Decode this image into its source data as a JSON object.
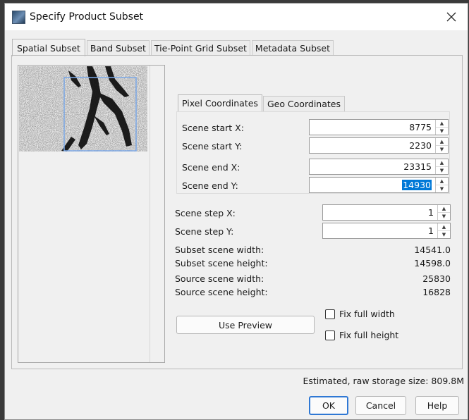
{
  "window": {
    "title": "Specify Product Subset"
  },
  "tabs": [
    {
      "label": "Spatial Subset",
      "active": true
    },
    {
      "label": "Band Subset",
      "active": false
    },
    {
      "label": "Tie-Point Grid Subset",
      "active": false
    },
    {
      "label": "Metadata Subset",
      "active": false
    }
  ],
  "coord_tabs": [
    {
      "label": "Pixel Coordinates",
      "active": true
    },
    {
      "label": "Geo Coordinates",
      "active": false
    }
  ],
  "fields": {
    "scene_start_x": {
      "label": "Scene start X:",
      "value": "8775"
    },
    "scene_start_y": {
      "label": "Scene start Y:",
      "value": "2230"
    },
    "scene_end_x": {
      "label": "Scene end X:",
      "value": "23315"
    },
    "scene_end_y": {
      "label": "Scene end Y:",
      "value": "14930"
    },
    "scene_step_x": {
      "label": "Scene step X:",
      "value": "1"
    },
    "scene_step_y": {
      "label": "Scene step Y:",
      "value": "1"
    }
  },
  "info": {
    "subset_width": {
      "label": "Subset scene width:",
      "value": "14541.0"
    },
    "subset_height": {
      "label": "Subset scene height:",
      "value": "14598.0"
    },
    "source_width": {
      "label": "Source scene width:",
      "value": "25830"
    },
    "source_height": {
      "label": "Source scene height:",
      "value": "16828"
    }
  },
  "buttons": {
    "use_preview": "Use Preview",
    "ok": "OK",
    "cancel": "Cancel",
    "help": "Help"
  },
  "checkboxes": {
    "fix_full_width": {
      "label": "Fix full width",
      "checked": false
    },
    "fix_full_height": {
      "label": "Fix full height",
      "checked": false
    }
  },
  "storage_estimate": "Estimated, raw storage size: 809.8M",
  "colors": {
    "selection_highlight": "#0078d7",
    "default_button_border": "#2f78d4",
    "subset_rectangle": "#7aa7e6"
  },
  "icons": {
    "close": "close-icon",
    "app": "app-icon",
    "spin_up": "chevron-up-icon",
    "spin_down": "chevron-down-icon"
  }
}
